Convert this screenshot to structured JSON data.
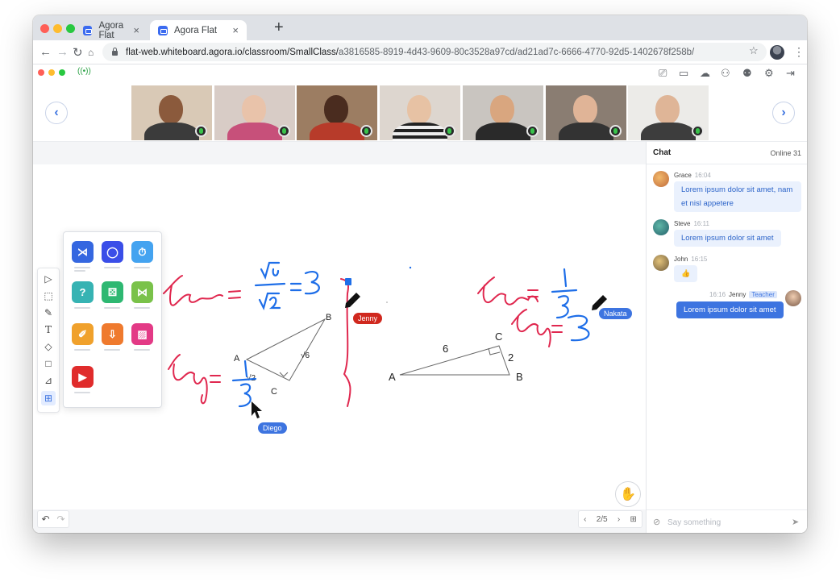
{
  "browser": {
    "tabs": [
      {
        "title": "Agora Flat",
        "close": "×"
      },
      {
        "title": "Agora Flat",
        "close": "×"
      }
    ],
    "new_tab": "+",
    "url_host": "flat-web.whiteboard.agora.io/classroom/SmallClass/",
    "url_path": "a3816585-8919-4d43-9609-80c3528a97cd/ad21ad7c-6666-4770-92d5-1402678f258b/"
  },
  "colors": {
    "accent": "#3d74e0",
    "ink_red": "#e0284f",
    "ink_blue": "#1e6ee8",
    "status_green": "#2ba245",
    "tag_red": "#d0281e"
  },
  "whiteboard": {
    "labels": {
      "A1": "A",
      "B1": "B",
      "C1": "C",
      "root2": "√2",
      "root6": "√6",
      "A2": "A",
      "B2": "B",
      "C2": "C",
      "six": "6",
      "two": "2"
    },
    "cursors": [
      {
        "name": "Jenny",
        "color": "#d0281e"
      },
      {
        "name": "Nakata",
        "color": "#3d74e0"
      },
      {
        "name": "Diego",
        "color": "#3d74e0"
      }
    ],
    "pager": {
      "prev": "‹",
      "text": "2/5",
      "next": "›"
    }
  },
  "chat": {
    "title": "Chat",
    "online": "Online 31",
    "messages": [
      {
        "name": "Grace",
        "time": "16:04",
        "text1": "Lorem ipsum dolor sit amet, nam",
        "text2": "et nisl appetere"
      },
      {
        "name": "Steve",
        "time": "16:11",
        "text": "Lorem ipsum dolor sit amet"
      },
      {
        "name": "John",
        "time": "16:15",
        "text": "👍"
      },
      {
        "name": "Jenny",
        "time": "16:16",
        "role": "Teacher",
        "text": "Lorem ipsum dolor sit amet"
      }
    ],
    "input_placeholder": "Say something"
  }
}
